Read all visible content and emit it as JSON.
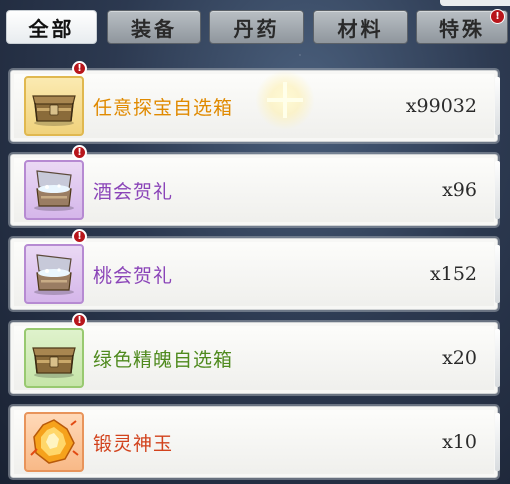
{
  "tabs": [
    {
      "label": "全部",
      "active": true,
      "alert": false
    },
    {
      "label": "装备",
      "active": false,
      "alert": false
    },
    {
      "label": "丹药",
      "active": false,
      "alert": false
    },
    {
      "label": "材料",
      "active": false,
      "alert": false
    },
    {
      "label": "特殊",
      "active": false,
      "alert": true
    }
  ],
  "alert_glyph": "!",
  "items": [
    {
      "name": "任意探宝自选箱",
      "count": "x99032",
      "name_color": "#e08a00",
      "quality": "gold",
      "icon": "ornate-chest-icon",
      "alert": true
    },
    {
      "name": "酒会贺礼",
      "count": "x96",
      "name_color": "#8a44b8",
      "quality": "purple",
      "icon": "open-gift-chest-icon",
      "alert": true
    },
    {
      "name": "桃会贺礼",
      "count": "x152",
      "name_color": "#8a44b8",
      "quality": "purple",
      "icon": "open-gift-chest-icon",
      "alert": true
    },
    {
      "name": "绿色精魄自选箱",
      "count": "x20",
      "name_color": "#4f8a1e",
      "quality": "green",
      "icon": "ornate-chest-icon",
      "alert": true
    },
    {
      "name": "锻灵神玉",
      "count": "x10",
      "name_color": "#d2421c",
      "quality": "orange",
      "icon": "spirit-jade-icon",
      "alert": false
    }
  ]
}
